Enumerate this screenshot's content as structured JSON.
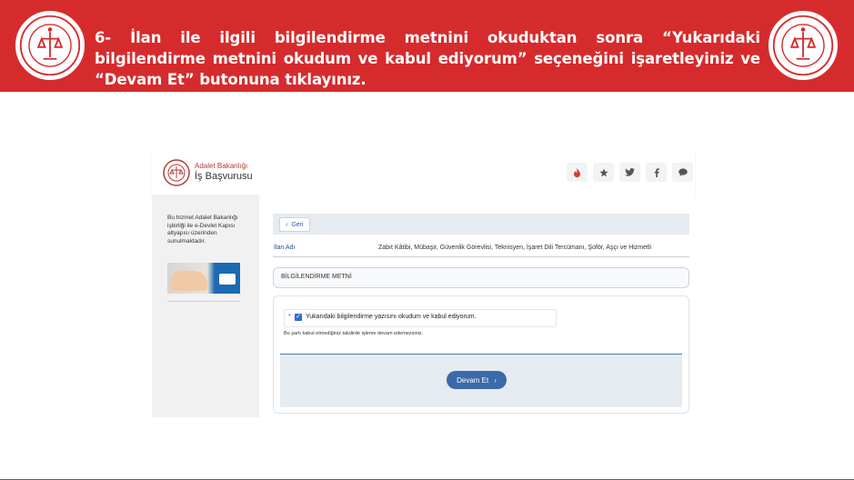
{
  "banner": {
    "instruction": "6- İlan ile ilgili bilgilendirme metnini okuduktan sonra “Yukarıdaki bilgilendirme metnini okudum ve kabul ediyorum” seçeneğini işaretleyiniz ve “Devam Et” butonuna tıklayınız.",
    "color": "#d62b2d"
  },
  "app": {
    "brand_top": "Adalet Bakanlığı",
    "brand_main": "İş Başvurusu",
    "social_icons": [
      "fire-icon",
      "star-icon",
      "twitter-icon",
      "facebook-icon",
      "chat-icon"
    ]
  },
  "sidebar": {
    "text": "Bu hizmet Adalet Bakanlığı işbirliği ile e-Devlet Kapısı altyapısı üzerinden sunulmaktadır."
  },
  "main": {
    "back_label": "Geri",
    "ilan_label": "İlan Adı",
    "ilan_value": "Zabıt Kâtibi, Mübaşir, Güvenlik Görevlisi, Teknisyen, İşaret Dili Tercümanı, Şoför, Aşçı ve Hizmetli",
    "info_title": "BİLGİLENDİRME METNİ",
    "required_mark": "*",
    "checkbox_label": "Yukarıdaki bilgilendirme yazısını okudum ve kabul ediyorum.",
    "checkbox_checked": true,
    "note": "Bu şartı kabul etmediğiniz takdirde işleme devam edemezsiniz.",
    "continue_label": "Devam Et"
  }
}
